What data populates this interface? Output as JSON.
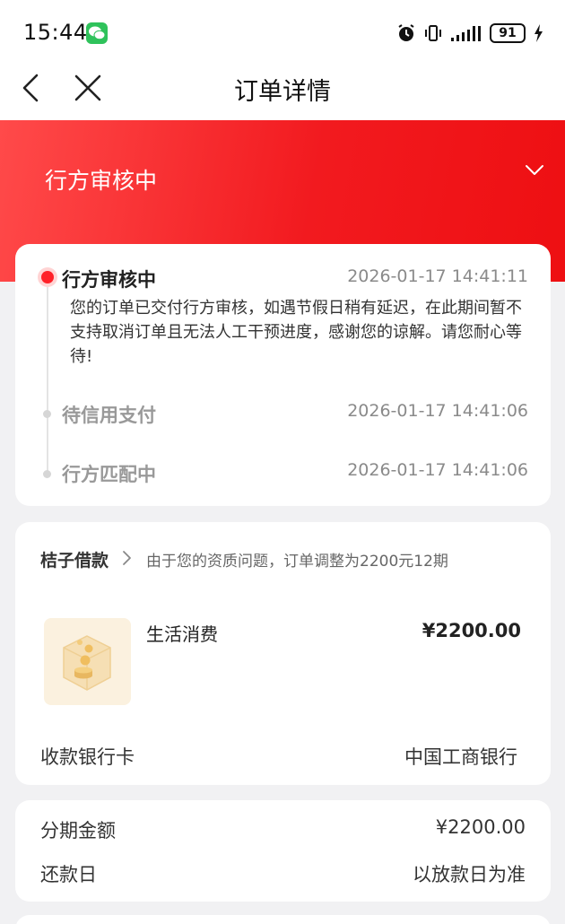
{
  "status_bar": {
    "time": "15:44",
    "battery": "91",
    "icons": [
      "wechat-icon",
      "alarm-icon",
      "vibrate-icon",
      "signal-icon",
      "battery-icon",
      "charging-icon"
    ]
  },
  "nav": {
    "title": "订单详情",
    "icons": [
      "back-icon",
      "close-icon"
    ]
  },
  "banner": {
    "status": "行方审核中",
    "icon": "chevron-down-icon"
  },
  "timeline": {
    "steps": [
      {
        "title": "行方审核中",
        "time": "2026-01-17 14:41:11",
        "active": true,
        "description": "您的订单已交付行方审核，如遇节假日稍有延迟，在此期间暂不支持取消订单且无法人工干预进度，感谢您的谅解。请您耐心等待!"
      },
      {
        "title": "待信用支付",
        "time": "2026-01-17 14:41:06",
        "active": false
      },
      {
        "title": "行方匹配中",
        "time": "2026-01-17 14:41:06",
        "active": false
      }
    ]
  },
  "loan": {
    "name": "桔子借款",
    "note": "由于您的资质问题，订单调整为2200元12期",
    "product_name": "生活消费",
    "product_amount": "¥2200.00",
    "bank_label": "收款银行卡",
    "bank_value": "中国工商银行"
  },
  "plan": {
    "rows": [
      {
        "label": "分期金额",
        "value": "¥2200.00"
      },
      {
        "label": "还款日",
        "value": "以放款日为准"
      }
    ]
  },
  "colors": {
    "accent": "#f21a1f",
    "page_bg": "#f1f1f3",
    "card_bg": "#ffffff",
    "muted_text": "#999999"
  }
}
